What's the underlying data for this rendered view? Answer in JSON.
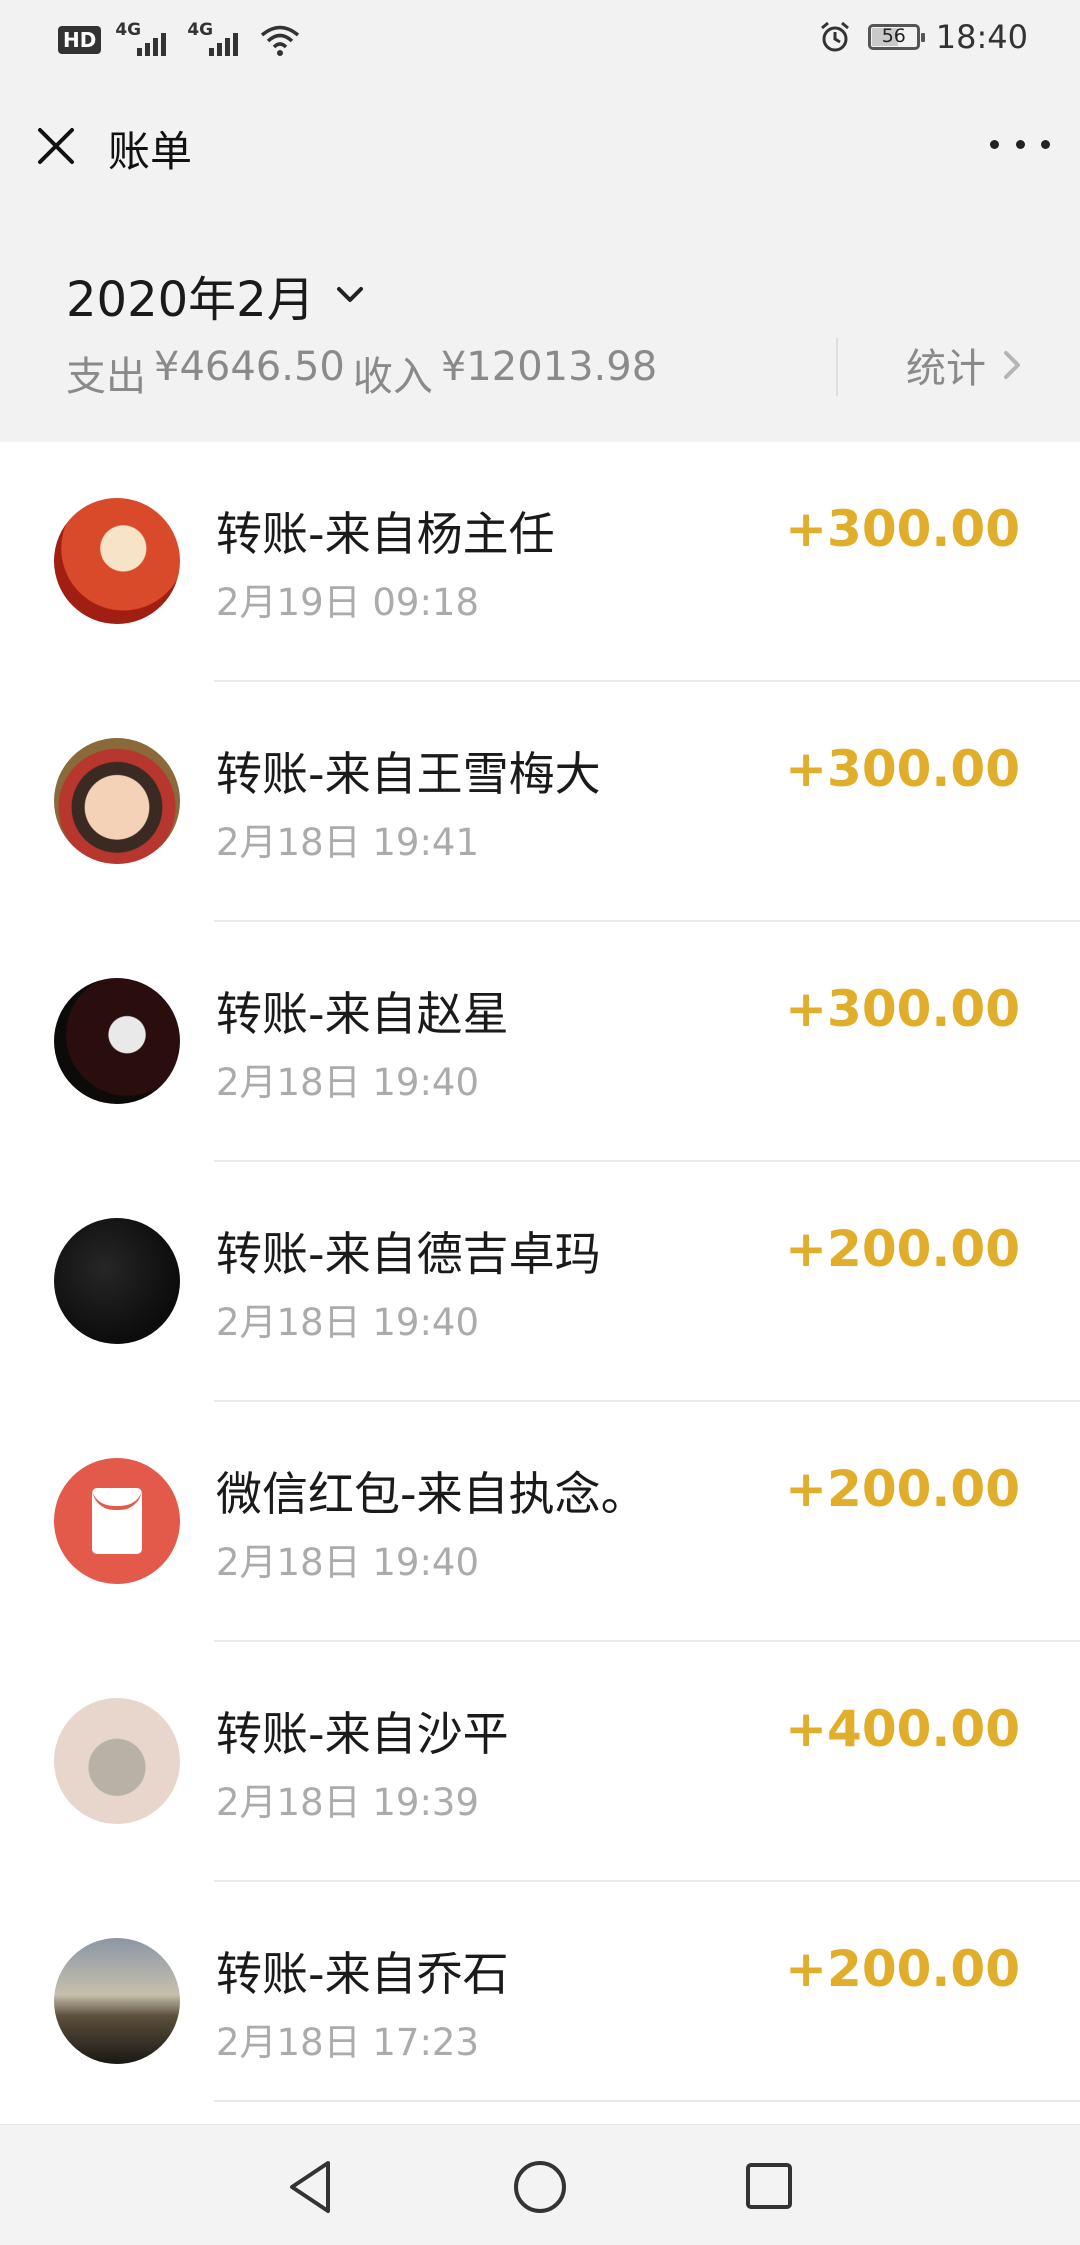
{
  "status_bar": {
    "hd_label": "HD",
    "network_1": "4G",
    "network_2": "4G",
    "battery_level": "56",
    "time": "18:40"
  },
  "header": {
    "title": "账单"
  },
  "summary": {
    "month": "2020年2月",
    "expense_label": "支出",
    "expense_value": "¥4646.50",
    "income_label": "收入",
    "income_value": "¥12013.98",
    "stats_label": "统计"
  },
  "transactions": [
    {
      "title": "转账-来自杨主任",
      "date": "2月19日 09:18",
      "amount": "+300.00"
    },
    {
      "title": "转账-来自王雪梅大",
      "date": "2月18日 19:41",
      "amount": "+300.00"
    },
    {
      "title": "转账-来自赵星",
      "date": "2月18日 19:40",
      "amount": "+300.00"
    },
    {
      "title": "转账-来自德吉卓玛",
      "date": "2月18日 19:40",
      "amount": "+200.00"
    },
    {
      "title": "微信红包-来自执念。",
      "date": "2月18日 19:40",
      "amount": "+200.00"
    },
    {
      "title": "转账-来自沙平",
      "date": "2月18日 19:39",
      "amount": "+400.00"
    },
    {
      "title": "转账-来自乔石",
      "date": "2月18日 17:23",
      "amount": "+200.00"
    }
  ],
  "colors": {
    "amount": "#e0ae2a",
    "header_bg": "#f2f2f3",
    "red_packet": "#e35a4a"
  },
  "icons": {
    "close": "close-icon",
    "more": "more-icon",
    "month_dropdown": "chevron-down-icon",
    "stats": "chevron-right-icon",
    "red_packet": "red-packet-icon",
    "nav_back": "triangle-back-icon",
    "nav_home": "circle-home-icon",
    "nav_recent": "square-recent-icon"
  }
}
